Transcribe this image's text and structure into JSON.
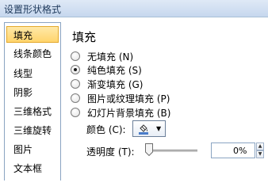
{
  "window": {
    "title": "设置形状格式"
  },
  "sidebar": {
    "items": [
      {
        "label": "填充",
        "selected": true
      },
      {
        "label": "线条颜色",
        "selected": false
      },
      {
        "label": "线型",
        "selected": false
      },
      {
        "label": "阴影",
        "selected": false
      },
      {
        "label": "三维格式",
        "selected": false
      },
      {
        "label": "三维旋转",
        "selected": false
      },
      {
        "label": "图片",
        "selected": false
      },
      {
        "label": "文本框",
        "selected": false
      }
    ]
  },
  "fill": {
    "title": "填充",
    "options": [
      {
        "label": "无填充 (N)",
        "checked": false
      },
      {
        "label": "纯色填充 (S)",
        "checked": true
      },
      {
        "label": "渐变填充 (G)",
        "checked": false
      },
      {
        "label": "图片或纹理填充 (P)",
        "checked": false
      },
      {
        "label": "幻灯片背景填充 (B)",
        "checked": false
      }
    ],
    "color_label": "颜色 (C):",
    "color_icon": "paint-bucket-icon",
    "transparency_label": "透明度 (T):",
    "transparency_value": "0%",
    "transparency_level": 0
  },
  "colors": {
    "selected_item_bg": "#ffd46c",
    "border": "#8aa4c2",
    "title_text": "#1e395b"
  }
}
